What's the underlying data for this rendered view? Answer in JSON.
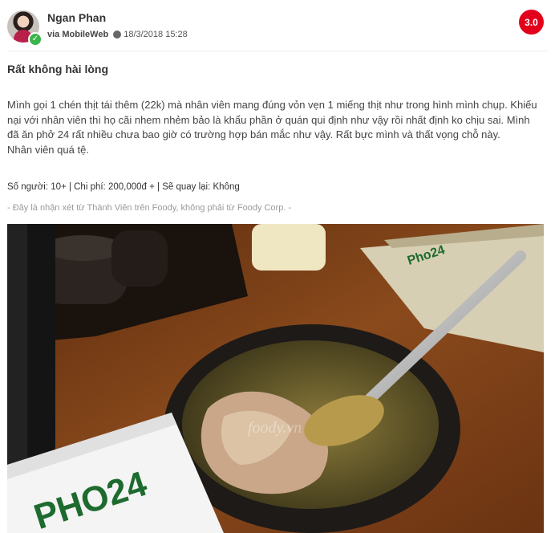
{
  "review": {
    "user_name": "Ngan Phan",
    "via": "via MobileWeb",
    "timestamp": "18/3/2018 15:28",
    "score": "3.0",
    "title": "Rất không hài lòng",
    "paragraph1": "Mình gọi 1 chén thịt tái thêm (22k) mà nhân viên mang đúng vỏn vẹn 1 miếng thịt như trong hình mình chụp. Khiếu nại với nhân viên thì họ cãi nhem nhẻm bảo là khẩu phần ở quán qui định như vậy rồi nhất định ko chịu sai. Mình đã ăn phở 24 rất nhiều chưa bao giờ có trường hợp bán mắc như vậy. Rất bực mình và thất vọng chỗ này.",
    "paragraph2": "Nhân viên quá tệ.",
    "stats": "Số người: 10+ | Chi phí: 200,000đ + | Sẽ quay lại: Không",
    "disclaimer": "- Đây là nhận xét từ Thành Viên trên Foody, không phải từ Foody Corp. -"
  },
  "icons": {
    "avatar": "user-avatar",
    "verified": "check-badge-icon",
    "privacy": "globe-icon"
  },
  "photo": {
    "packet_text": "PHO24",
    "mat_text": "Pho24",
    "watermark": "foody.vn"
  },
  "colors": {
    "score_bg": "#e3001b",
    "verified": "#3bb54a",
    "disclaimer": "#9a9a9a"
  }
}
